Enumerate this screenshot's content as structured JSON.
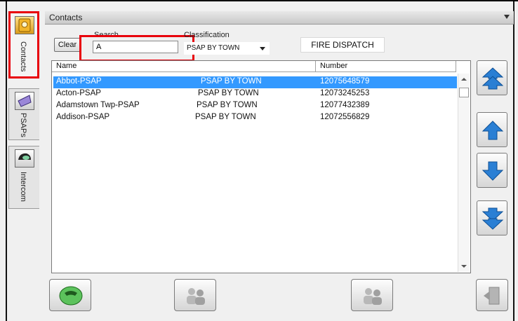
{
  "sidebar": {
    "tabs": [
      {
        "label": "Contacts",
        "icon": "address-book-icon",
        "active": true
      },
      {
        "label": "PSAPs",
        "icon": "psap-diamond-icon",
        "active": false
      },
      {
        "label": "Intercom",
        "icon": "intercom-helmet-icon",
        "active": false
      }
    ]
  },
  "header": {
    "title": "Contacts"
  },
  "filters": {
    "clear_label": "Clear",
    "search_label": "Search",
    "search_value": "A",
    "classification_label": "Classification",
    "classification_value": "PSAP BY TOWN",
    "fire_dispatch": "FIRE DISPATCH"
  },
  "list": {
    "columns": [
      "Name",
      "Number"
    ],
    "rows": [
      {
        "name": "Abbot-PSAP",
        "classification": "PSAP BY TOWN",
        "number": "12075648579",
        "selected": true
      },
      {
        "name": "Acton-PSAP",
        "classification": "PSAP BY TOWN",
        "number": "12073245253",
        "selected": false
      },
      {
        "name": "Adamstown Twp-PSAP",
        "classification": "PSAP BY TOWN",
        "number": "12077432389",
        "selected": false
      },
      {
        "name": "Addison-PSAP",
        "classification": "PSAP BY TOWN",
        "number": "12072556829",
        "selected": false
      }
    ]
  },
  "nav_buttons": [
    {
      "name": "page-up",
      "icon": "double-up-arrow-icon"
    },
    {
      "name": "row-up",
      "icon": "up-arrow-icon"
    },
    {
      "name": "row-down",
      "icon": "down-arrow-icon"
    },
    {
      "name": "page-down",
      "icon": "double-down-arrow-icon"
    }
  ],
  "actions": [
    {
      "name": "call",
      "icon": "phone-handset-icon"
    },
    {
      "name": "contact-group-1",
      "icon": "people-group-icon"
    },
    {
      "name": "contact-group-2",
      "icon": "people-group-icon"
    },
    {
      "name": "exit",
      "icon": "exit-door-icon"
    }
  ],
  "colors": {
    "selection": "#3399ff",
    "highlight": "#e8000b",
    "nav_blue": "#2a7fd4"
  }
}
